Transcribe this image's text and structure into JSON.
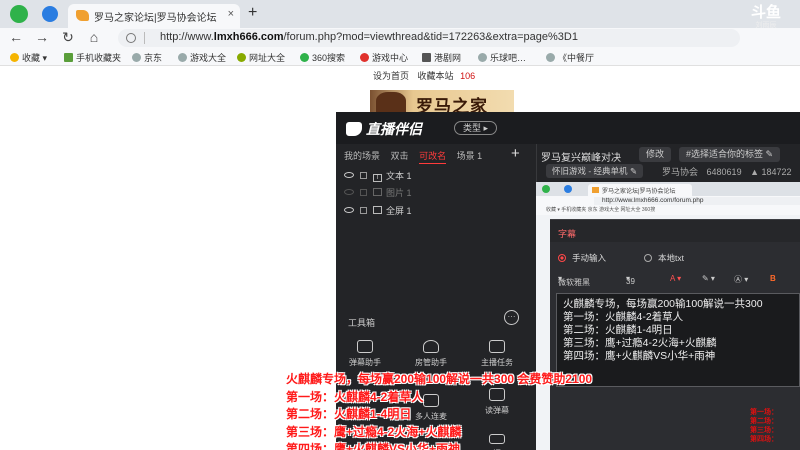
{
  "browser": {
    "tab_title": "罗马之家论坛|罗马协会论坛",
    "tab_close": "×",
    "tab_new": "+",
    "url_prefix": "http://www.",
    "url_domain": "lmxh666.com",
    "url_path": "/forum.php?mod=viewthread&tid=172263&extra=page%3D1",
    "bookmarks": [
      "收藏",
      "手机收藏夹",
      "京东",
      "游戏大全",
      "网址大全",
      "360搜索",
      "游戏中心",
      "港剧网",
      "乐球吧…",
      "《中餐厅"
    ]
  },
  "stream_watermark": {
    "top": "斗鱼",
    "bottom": "刘雨辰"
  },
  "forum": {
    "link_home": "设为首页",
    "link_fav": "收藏本站",
    "link_count": "106",
    "banner_text": "罗马之家"
  },
  "app": {
    "logo_text": "直播伴侣",
    "type_label": "类型 ▸",
    "scene_tabs": [
      "我的场景",
      "双击",
      "可改名",
      "场景 1"
    ],
    "scene_add": "+",
    "sources": [
      {
        "label": "文本 1",
        "type": "T"
      },
      {
        "label": "图片 1",
        "type": ""
      },
      {
        "label": "全屏 1",
        "type": ""
      }
    ],
    "toolbox_title": "工具箱",
    "toolbox_more": "···",
    "tools": [
      "弹幕助手",
      "房管助手",
      "主播任务",
      "多人连麦",
      "读弹幕",
      "调"
    ],
    "room_title": "罗马复兴巅峰对决",
    "room_modify": "修改",
    "room_tag": "#选择适合你的标签",
    "room_category": "怀旧游戏 - 经典单机",
    "room_assoc": "罗马协会",
    "room_id": "6480619",
    "room_heat": "184722"
  },
  "preview": {
    "tab_title": "罗马之家论坛|罗马协会论坛",
    "url": "http://www.lmxh666.com/forum.php",
    "bookmarks": "收藏 ▾  手机收藏夹  京东  游戏大全  网址大全  360搜"
  },
  "dialog": {
    "title": "字幕",
    "mode_manual": "手动输入",
    "mode_file": "本地txt",
    "font_name": "微软雅黑",
    "font_size": "39",
    "bold": "B",
    "lines": [
      "火麒麟专场，每场赢200输100解说一共300",
      "第一场：火麒麟4-2着草人",
      "第二场：火麒麟1-4明日",
      "第三场：鹰+过瘾4-2火海+火麒麟",
      "第四场：鹰+火麒麟VS小华+雨神"
    ]
  },
  "preview_overlay": [
    "第一场：",
    "第二场：",
    "第三场：",
    "第四场："
  ],
  "overlay": {
    "line0": "火麒麟专场，每场赢200输100解说一共300 会费赞助2100",
    "line1": "第一场：火麒麟4-2着草人",
    "line2": "第二场：火麒麟1-4明日",
    "line3": "第三场：鹰+过瘾4-2火海+火麒麟",
    "line4": "第四场：鹰+火麒麟VS小华+雨神"
  },
  "colors": {
    "accent_red": "#ff1a1a",
    "app_bg": "#232427"
  }
}
